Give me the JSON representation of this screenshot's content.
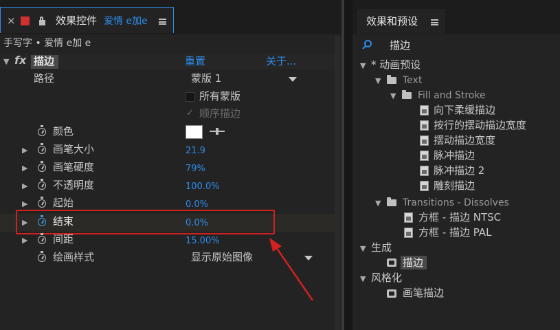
{
  "effect_controls_panel": {
    "close_glyph": "×",
    "lock_glyph": "🔓",
    "tab_title": "效果控件",
    "tab_layer_name": "爱情 e加e",
    "breadcrumb": "手写字 • 爱情 e加 e",
    "effect": {
      "fx_label": "fx",
      "name": "描边",
      "reset_label": "重置",
      "about_label": "关于..."
    },
    "properties": [
      {
        "label": "路径",
        "value": "蒙版 1"
      },
      {
        "label": "",
        "value": "所有蒙版"
      },
      {
        "label": "",
        "value": "顺序描边"
      },
      {
        "label": "颜色",
        "value": ""
      },
      {
        "label": "画笔大小",
        "value": "21.9"
      },
      {
        "label": "画笔硬度",
        "value": "79%"
      },
      {
        "label": "不透明度",
        "value": "100.0%"
      },
      {
        "label": "起始",
        "value": "0.0%"
      },
      {
        "label": "结束",
        "value": "0.0%"
      },
      {
        "label": "间距",
        "value": "15.00%"
      },
      {
        "label": "绘画样式",
        "value": "显示原始图像"
      }
    ],
    "color_swatch": "#ffffff",
    "highlight_color": "#d22020",
    "arrow_color": "#d42020"
  },
  "effects_presets_panel": {
    "tab_title": "效果和预设",
    "search_query": "描边",
    "tree": [
      {
        "label": "* 动画预设"
      },
      {
        "label": "Text"
      },
      {
        "label": "Fill and Stroke"
      },
      {
        "label": "向下柔缓描边"
      },
      {
        "label": "按行的摆动描边宽度"
      },
      {
        "label": "摆动描边宽度"
      },
      {
        "label": "脉冲描边"
      },
      {
        "label": "脉冲描边 2"
      },
      {
        "label": "雕刻描边"
      },
      {
        "label": "Transitions - Dissolves"
      },
      {
        "label": "方框 - 描边 NTSC"
      },
      {
        "label": "方框 - 描边 PAL"
      },
      {
        "label": "生成"
      },
      {
        "label": "描边"
      },
      {
        "label": "风格化"
      },
      {
        "label": "画笔描边"
      }
    ]
  },
  "colors": {
    "accent_blue": "#2d8ceb",
    "panel_bg": "#232323"
  }
}
